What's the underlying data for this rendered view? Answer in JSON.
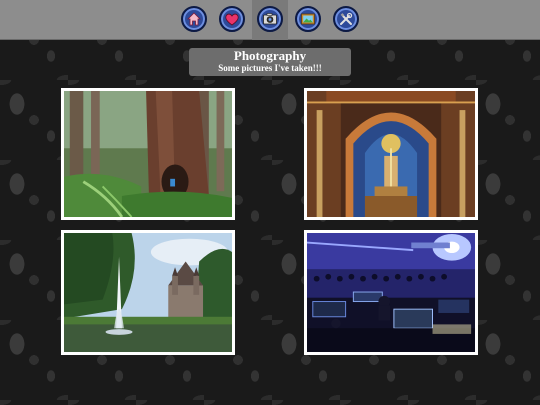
{
  "nav": {
    "items": [
      {
        "icon": "home-icon",
        "active": false
      },
      {
        "icon": "heart-icon",
        "active": false
      },
      {
        "icon": "camera-icon",
        "active": true
      },
      {
        "icon": "picture-frame-icon",
        "active": false
      },
      {
        "icon": "tools-icon",
        "active": false
      }
    ],
    "colors": {
      "bar": "#8d8d8d",
      "button": "#2d4a9a",
      "button_border": "#0d1a44"
    }
  },
  "header": {
    "title": "Photography",
    "subtitle": "Some pictures I've taken!!!"
  },
  "gallery": {
    "photos": [
      {
        "subject": "redwood-forest"
      },
      {
        "subject": "church-interior"
      },
      {
        "subject": "castle-fountain"
      },
      {
        "subject": "concert-stage"
      }
    ]
  }
}
